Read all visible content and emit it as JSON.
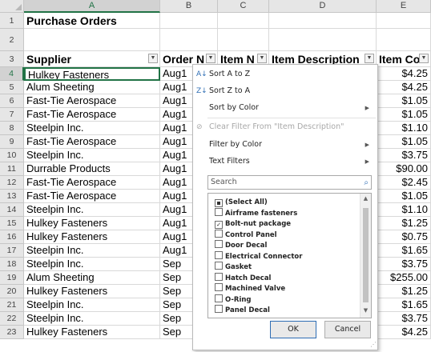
{
  "columns": [
    "A",
    "B",
    "C",
    "D",
    "E"
  ],
  "title": "Purchase Orders",
  "headers": {
    "supplier": "Supplier",
    "order": "Order N",
    "item_no": "Item N",
    "item_desc": "Item Description",
    "item_cost": "Item Co"
  },
  "row_numbers": [
    "1",
    "2",
    "3",
    "4",
    "5",
    "6",
    "7",
    "8",
    "9",
    "10",
    "11",
    "12",
    "13",
    "14",
    "15",
    "16",
    "17",
    "18",
    "19",
    "20",
    "21",
    "22",
    "23"
  ],
  "suppliers": [
    "Hulkey Fasteners",
    "Alum Sheeting",
    "Fast-Tie Aerospace",
    "Fast-Tie Aerospace",
    "Steelpin Inc.",
    "Fast-Tie Aerospace",
    "Steelpin Inc.",
    "Durrable Products",
    "Fast-Tie Aerospace",
    "Fast-Tie Aerospace",
    "Steelpin Inc.",
    "Hulkey Fasteners",
    "Hulkey Fasteners",
    "Steelpin Inc.",
    "Steelpin Inc.",
    "Alum Sheeting",
    "Hulkey Fasteners",
    "Steelpin Inc.",
    "Steelpin Inc.",
    "Hulkey Fasteners"
  ],
  "order_dates": [
    "Aug1",
    "Aug1",
    "Aug1",
    "Aug1",
    "Aug1",
    "Aug1",
    "Aug1",
    "Aug1",
    "Aug1",
    "Aug1",
    "Aug1",
    "Aug1",
    "Aug1",
    "Aug1",
    "Sep",
    "Sep",
    "Sep",
    "Sep",
    "Sep",
    "Sep"
  ],
  "costs": [
    "$4.25",
    "$4.25",
    "$1.05",
    "$1.05",
    "$1.10",
    "$1.05",
    "$3.75",
    "$90.00",
    "$2.45",
    "$1.05",
    "$1.10",
    "$1.25",
    "$0.75",
    "$1.65",
    "$3.75",
    "$255.00",
    "$1.25",
    "$1.65",
    "$3.75",
    "$4.25"
  ],
  "filter_menu": {
    "sort_az": "Sort A to Z",
    "sort_za": "Sort Z to A",
    "sort_color": "Sort by Color",
    "clear_filter": "Clear Filter From \"Item Description\"",
    "filter_color": "Filter by Color",
    "text_filters": "Text Filters",
    "search_placeholder": "Search",
    "items": [
      {
        "label": "(Select All)",
        "state": "mixed"
      },
      {
        "label": "Airframe fasteners",
        "state": "unchecked"
      },
      {
        "label": "Bolt-nut package",
        "state": "checked"
      },
      {
        "label": "Control Panel",
        "state": "unchecked"
      },
      {
        "label": "Door Decal",
        "state": "unchecked"
      },
      {
        "label": "Electrical Connector",
        "state": "unchecked"
      },
      {
        "label": "Gasket",
        "state": "unchecked"
      },
      {
        "label": "Hatch Decal",
        "state": "unchecked"
      },
      {
        "label": "Machined Valve",
        "state": "unchecked"
      },
      {
        "label": "O-Ring",
        "state": "unchecked"
      },
      {
        "label": "Panel Decal",
        "state": "unchecked"
      }
    ],
    "ok_label": "OK",
    "cancel_label": "Cancel"
  }
}
